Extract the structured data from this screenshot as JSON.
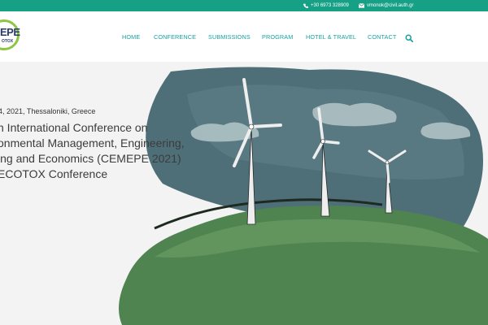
{
  "topbar": {
    "phone": "+30 6973 328909",
    "email": "vmonok@civil.auth.gr"
  },
  "logo": {
    "main": "EPE",
    "sub": "OTOX"
  },
  "nav": {
    "items": [
      "HOME",
      "CONFERENCE",
      "SUBMISSIONS",
      "PROGRAM",
      "HOTEL & TRAVEL",
      "CONTACT"
    ]
  },
  "hero": {
    "date": "4, 2021, Thessaloniki, Greece",
    "title_lines": [
      "n International Conference on",
      "onmental Management, Engineering,",
      "ing and Economics (CEMEPE 2021)",
      "ECOTOX Conference"
    ]
  },
  "colors": {
    "topbar": "#16a085",
    "nav": "#17a2a0",
    "logo_ring": "#8dc63f",
    "sky": "#4f6f78",
    "hill": "#4f8350"
  }
}
